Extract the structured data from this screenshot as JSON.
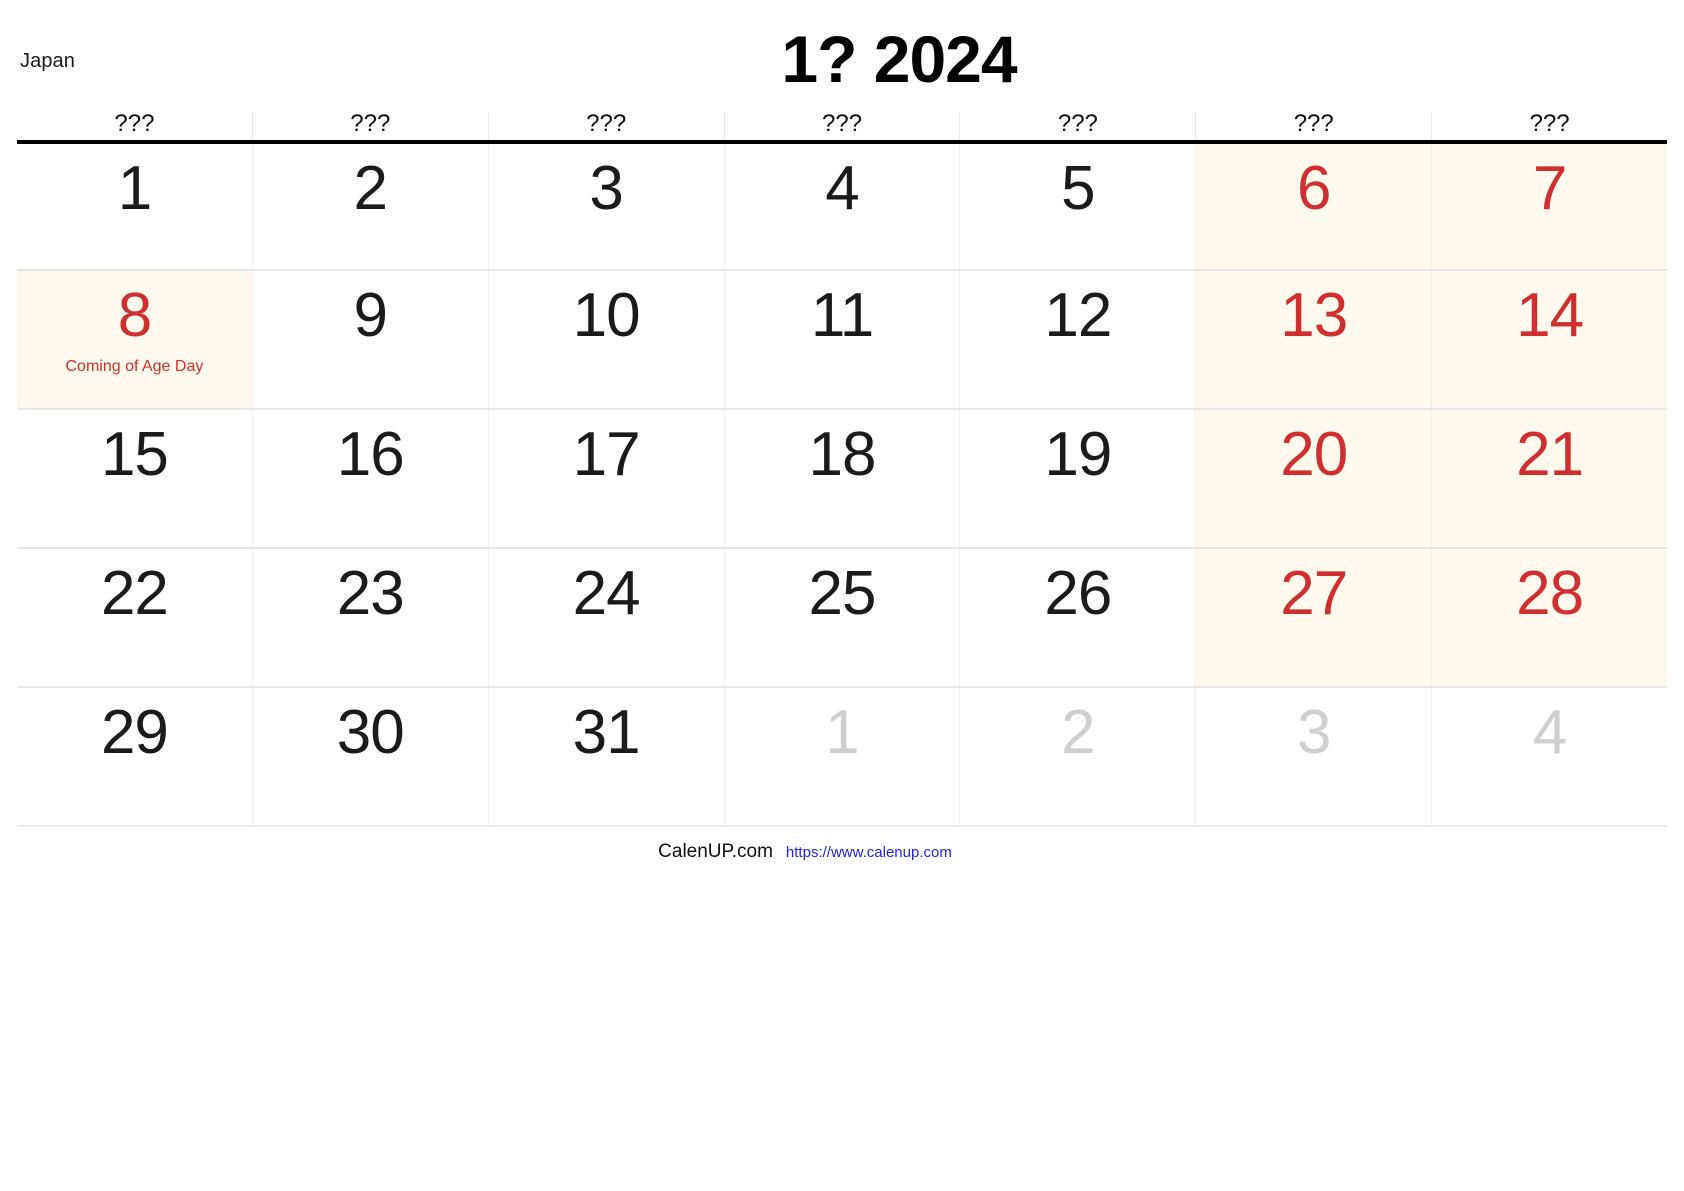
{
  "header": {
    "country": "Japan",
    "title": "1? 2024"
  },
  "weekdays": [
    "???",
    "???",
    "???",
    "???",
    "???",
    "???",
    "???"
  ],
  "colors": {
    "weekend_text": "#cf2f2f",
    "weekend_background": "#fdf9ec",
    "holiday_text": "#cf2f2f",
    "holiday_background": "#fdf9ec",
    "other_month_text": "#cfcfcf",
    "normal_text": "#1b1b1b",
    "rule": "#000000",
    "link": "#2222dd"
  },
  "weeks": [
    [
      {
        "num": "1",
        "type": "normal",
        "label": ""
      },
      {
        "num": "2",
        "type": "normal",
        "label": ""
      },
      {
        "num": "3",
        "type": "normal",
        "label": ""
      },
      {
        "num": "4",
        "type": "normal",
        "label": ""
      },
      {
        "num": "5",
        "type": "normal",
        "label": ""
      },
      {
        "num": "6",
        "type": "weekend",
        "label": ""
      },
      {
        "num": "7",
        "type": "weekend",
        "label": ""
      }
    ],
    [
      {
        "num": "8",
        "type": "holiday",
        "label": "Coming of Age Day"
      },
      {
        "num": "9",
        "type": "normal",
        "label": ""
      },
      {
        "num": "10",
        "type": "normal",
        "label": ""
      },
      {
        "num": "11",
        "type": "normal",
        "label": ""
      },
      {
        "num": "12",
        "type": "normal",
        "label": ""
      },
      {
        "num": "13",
        "type": "weekend",
        "label": ""
      },
      {
        "num": "14",
        "type": "weekend",
        "label": ""
      }
    ],
    [
      {
        "num": "15",
        "type": "normal",
        "label": ""
      },
      {
        "num": "16",
        "type": "normal",
        "label": ""
      },
      {
        "num": "17",
        "type": "normal",
        "label": ""
      },
      {
        "num": "18",
        "type": "normal",
        "label": ""
      },
      {
        "num": "19",
        "type": "normal",
        "label": ""
      },
      {
        "num": "20",
        "type": "weekend",
        "label": ""
      },
      {
        "num": "21",
        "type": "weekend",
        "label": ""
      }
    ],
    [
      {
        "num": "22",
        "type": "normal",
        "label": ""
      },
      {
        "num": "23",
        "type": "normal",
        "label": ""
      },
      {
        "num": "24",
        "type": "normal",
        "label": ""
      },
      {
        "num": "25",
        "type": "normal",
        "label": ""
      },
      {
        "num": "26",
        "type": "normal",
        "label": ""
      },
      {
        "num": "27",
        "type": "weekend",
        "label": ""
      },
      {
        "num": "28",
        "type": "weekend",
        "label": ""
      }
    ],
    [
      {
        "num": "29",
        "type": "normal",
        "label": ""
      },
      {
        "num": "30",
        "type": "normal",
        "label": ""
      },
      {
        "num": "31",
        "type": "normal",
        "label": ""
      },
      {
        "num": "1",
        "type": "other",
        "label": ""
      },
      {
        "num": "2",
        "type": "other",
        "label": ""
      },
      {
        "num": "3",
        "type": "other",
        "label": ""
      },
      {
        "num": "4",
        "type": "other",
        "label": ""
      }
    ]
  ],
  "footer": {
    "brand": "CalenUP.com",
    "url": "https://www.calenup.com"
  }
}
